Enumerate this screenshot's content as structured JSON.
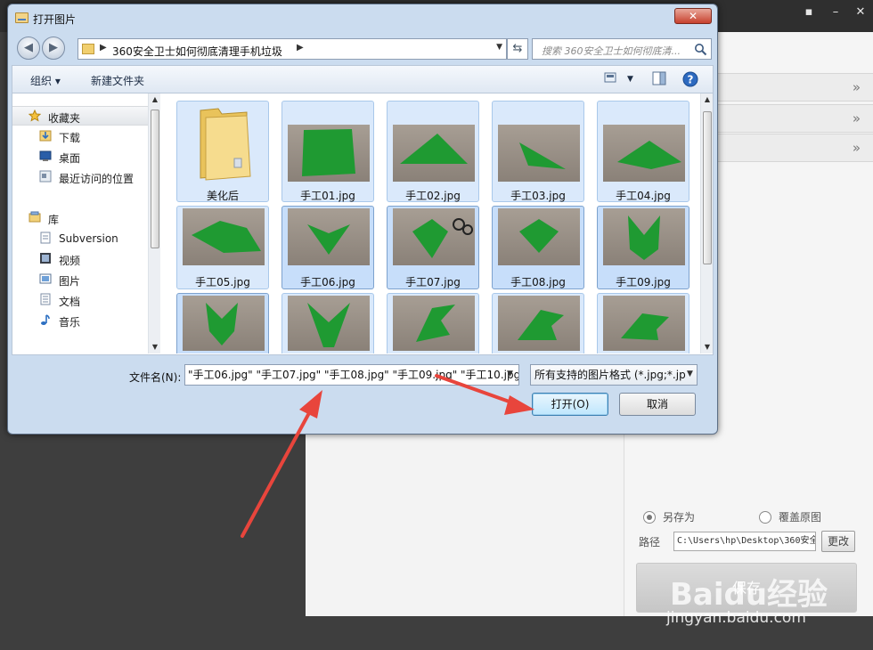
{
  "dialog": {
    "title": "打开图片",
    "close": "✕"
  },
  "address": {
    "path": "360安全卫士如何彻底清理手机垃圾",
    "search_placeholder": "搜索 360安全卫士如何彻底清..."
  },
  "toolbar": {
    "organize": "组织",
    "new_folder": "新建文件夹"
  },
  "sidebar": {
    "favorites": "收藏夹",
    "fav_items": [
      "下载",
      "桌面",
      "最近访问的位置"
    ],
    "libraries": "库",
    "lib_items": [
      "Subversion",
      "视频",
      "图片",
      "文档",
      "音乐"
    ]
  },
  "files": [
    {
      "label": "美化后",
      "kind": "folder"
    },
    {
      "label": "手工01.jpg",
      "kind": "photo"
    },
    {
      "label": "手工02.jpg",
      "kind": "photo"
    },
    {
      "label": "手工03.jpg",
      "kind": "photo"
    },
    {
      "label": "手工04.jpg",
      "kind": "photo"
    },
    {
      "label": "手工05.jpg",
      "kind": "photo"
    },
    {
      "label": "手工06.jpg",
      "kind": "photo"
    },
    {
      "label": "手工07.jpg",
      "kind": "photo"
    },
    {
      "label": "手工08.jpg",
      "kind": "photo"
    },
    {
      "label": "手工09.jpg",
      "kind": "photo"
    }
  ],
  "footer": {
    "filename_label": "文件名(N):",
    "filename_value": "\"手工06.jpg\" \"手工07.jpg\" \"手工08.jpg\" \"手工09.jpg\" \"手工10.jpg\"",
    "filter_value": "所有支持的图片格式 (*.jpg;*.jp",
    "open_button": "打开(O)",
    "cancel_button": "取消"
  },
  "background_app": {
    "save_as_label": "另存为",
    "overwrite_label": "覆盖原图",
    "path_label": "路径",
    "path_value": "C:\\Users\\hp\\Desktop\\360安全",
    "change_button": "更改",
    "save_button": "保存",
    "save_as_selected": true
  },
  "watermark": {
    "logo": "Baidu经验",
    "url": "jingyan.baidu.com"
  },
  "colors": {
    "arrow": "#e8453c",
    "paper_green": "#1f9a32"
  }
}
